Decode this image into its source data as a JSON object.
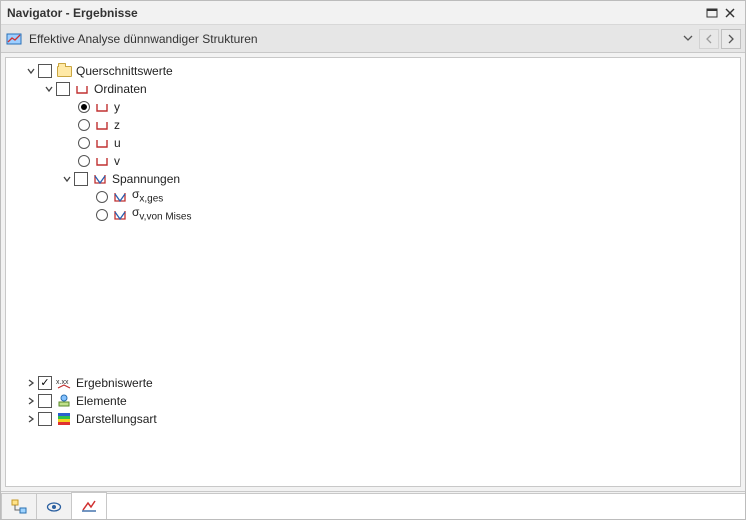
{
  "window": {
    "title": "Navigator - Ergebnisse"
  },
  "analysis": {
    "label": "Effektive Analyse dünnwandiger Strukturen"
  },
  "tree": {
    "querschnittswerte": {
      "label": "Querschnittswerte"
    },
    "ordinaten": {
      "label": "Ordinaten"
    },
    "ord_y": {
      "label": "y"
    },
    "ord_z": {
      "label": "z"
    },
    "ord_u": {
      "label": "u"
    },
    "ord_v": {
      "label": "v"
    },
    "spannungen": {
      "label": "Spannungen"
    },
    "sig_xges_prefix": "σ",
    "sig_xges_sub": "x,ges",
    "sig_vmises_prefix": "σ",
    "sig_vmises_sub": "v,von Mises",
    "ergebniswerte": {
      "label": "Ergebniswerte"
    },
    "elemente": {
      "label": "Elemente"
    },
    "darstellungsart": {
      "label": "Darstellungsart"
    }
  }
}
